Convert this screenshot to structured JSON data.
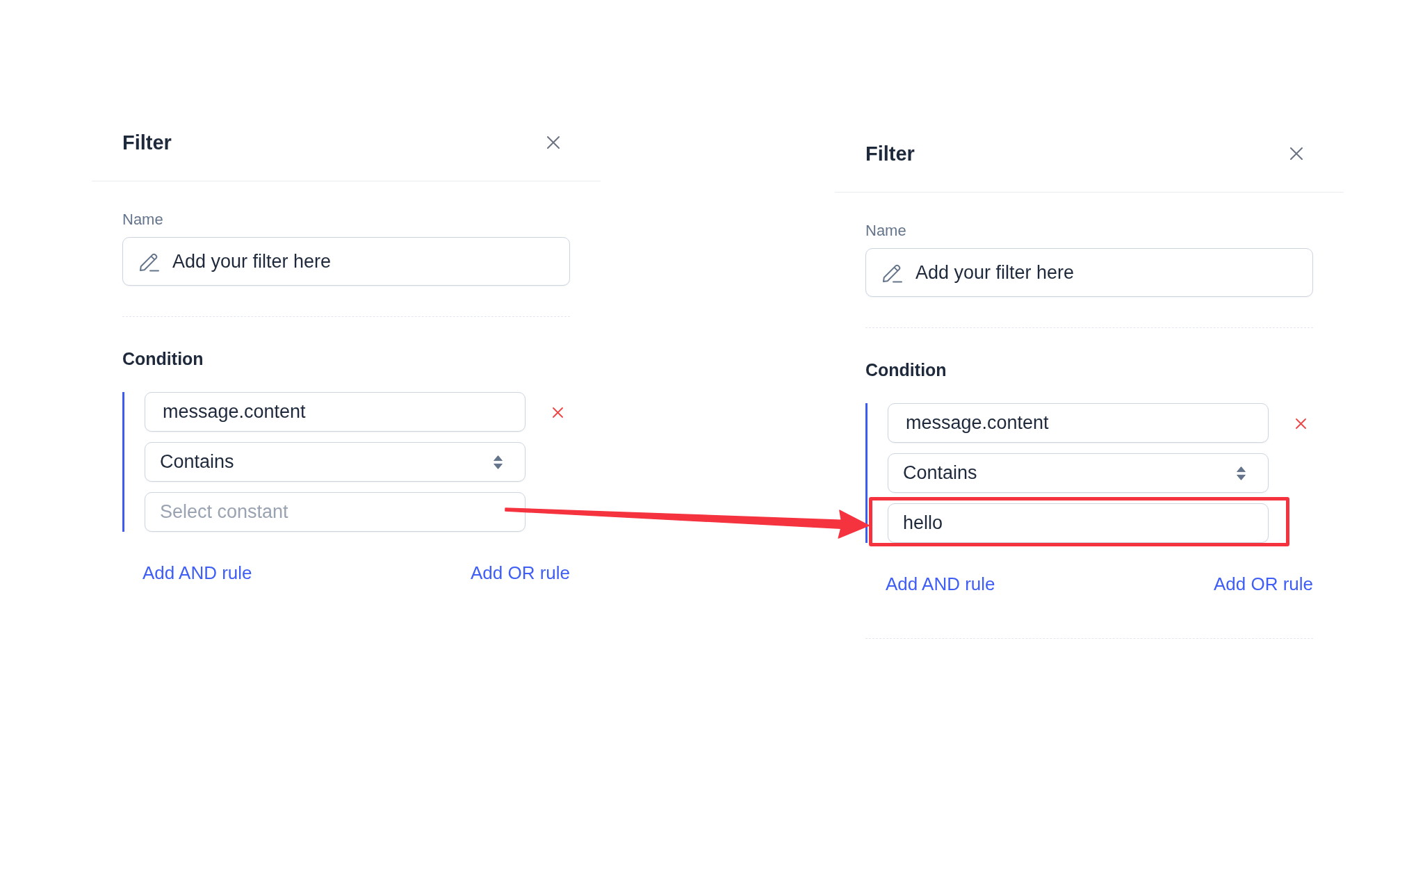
{
  "panels": [
    {
      "title": "Filter",
      "name_field": {
        "label": "Name",
        "placeholder": "Add your filter here"
      },
      "condition": {
        "heading": "Condition",
        "rules": [
          {
            "field": {
              "value": "message.content"
            },
            "operator": {
              "value": "Contains"
            },
            "constant": {
              "placeholder": "Select constant",
              "highlighted": false
            }
          }
        ],
        "add_and": "Add AND rule",
        "add_or": "Add OR rule"
      }
    },
    {
      "title": "Filter",
      "name_field": {
        "label": "Name",
        "placeholder": "Add your filter here"
      },
      "condition": {
        "heading": "Condition",
        "rules": [
          {
            "field": {
              "value": "message.content"
            },
            "operator": {
              "value": "Contains"
            },
            "constant": {
              "value": "hello",
              "highlighted": true
            }
          }
        ],
        "add_and": "Add AND rule",
        "add_or": "Add OR rule"
      },
      "footer_divider": true
    }
  ]
}
